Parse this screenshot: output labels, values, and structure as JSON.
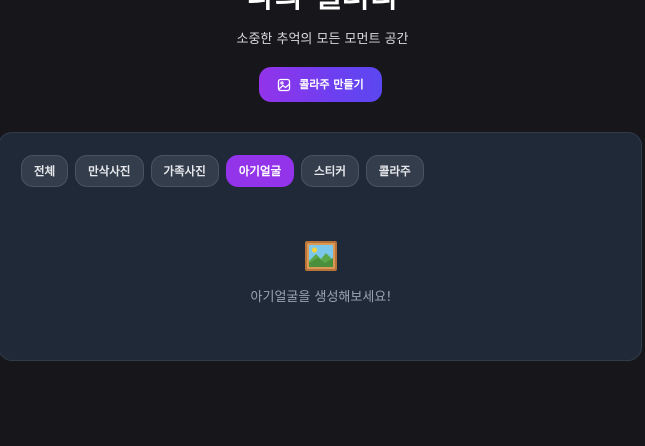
{
  "header": {
    "title": "나의 갤러리",
    "subtitle": "소중한 추억의 모든 모먼트 공간"
  },
  "actions": {
    "collage_button_label": "콜라주 만들기",
    "collage_button_icon": "image-icon"
  },
  "gallery": {
    "tabs": [
      {
        "label": "전체",
        "active": false
      },
      {
        "label": "만삭사진",
        "active": false
      },
      {
        "label": "가족사진",
        "active": false
      },
      {
        "label": "아기얼굴",
        "active": true
      },
      {
        "label": "스티커",
        "active": false
      },
      {
        "label": "콜라주",
        "active": false
      }
    ],
    "empty_state": {
      "icon": "framed-picture-icon",
      "message": "아기얼굴을 생성해보세요!"
    }
  },
  "colors": {
    "background": "#16161b",
    "panel": "#1f2937",
    "accent": "#9333ea",
    "accent_gradient_end": "#5b47f0",
    "tab_inactive": "#343d4b",
    "muted_text": "#9aa3b2"
  }
}
